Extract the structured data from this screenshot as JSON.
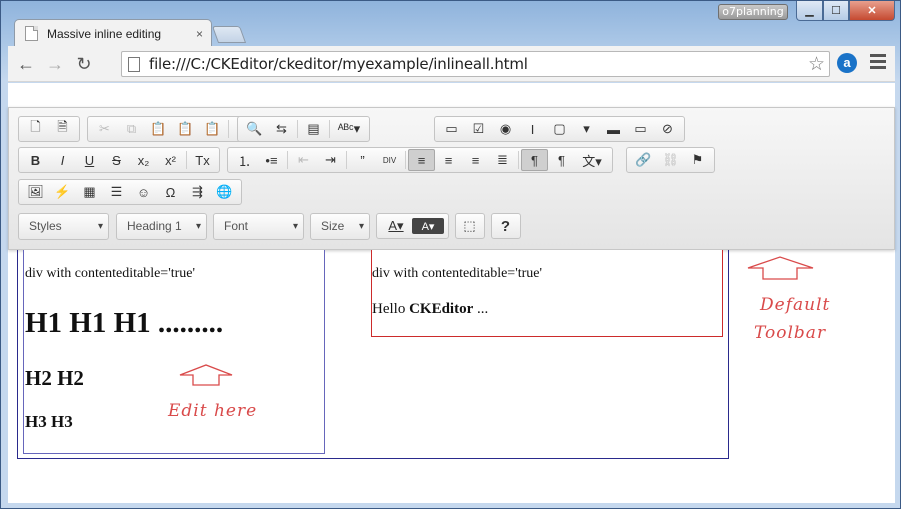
{
  "window": {
    "user_badge": "o7planning",
    "controls": {
      "minimize": "▁",
      "maximize": "☐",
      "close": "✕"
    }
  },
  "tabs": [
    {
      "label": "Massive inline editing",
      "close": "×",
      "active": true
    }
  ],
  "navbar": {
    "back": "←",
    "forward": "→",
    "reload": "↻",
    "url": "file:///C:/CKEditor/ckeditor/myexample/inlineall.html",
    "star": "☆",
    "extension": "a"
  },
  "editor_toolbar": {
    "rows": [
      [
        [
          "page-icon",
          "document-icon"
        ],
        [
          "cut-icon",
          "copy-icon",
          "paste-icon",
          "paste-text-icon",
          "paste-word-icon",
          "|",
          "undo-icon",
          "redo-icon"
        ],
        [
          "find-icon",
          "replace-icon",
          "|",
          "select-all-icon",
          "|",
          "spellcheck-icon"
        ],
        [
          "form-icon",
          "checkbox-icon",
          "radio-icon",
          "textfield-icon",
          "textarea-icon",
          "select-icon",
          "button-icon",
          "imagebutton-icon",
          "hiddenfield-icon"
        ]
      ],
      [
        [
          "bold-icon",
          "italic-icon",
          "underline-icon",
          "strike-icon",
          "subscript-icon",
          "superscript-icon",
          "|",
          "removeformat-icon"
        ],
        [
          "numbered-list-icon",
          "bulleted-list-icon",
          "|",
          "outdent-icon",
          "indent-icon",
          "|",
          "blockquote-icon",
          "creatediv-icon",
          "|",
          "align-left-icon",
          "align-center-icon",
          "align-right-icon",
          "justify-icon",
          "|",
          "ltr-icon",
          "rtl-icon",
          "language-icon"
        ],
        [
          "link-icon",
          "unlink-icon",
          "anchor-icon"
        ]
      ],
      [
        [
          "image-icon",
          "flash-icon",
          "table-icon",
          "hr-icon",
          "smiley-icon",
          "specialchar-icon",
          "pagebreak-icon",
          "iframe-icon"
        ]
      ]
    ],
    "glyphs": {
      "page-icon": "🗋",
      "document-icon": "🗎",
      "cut-icon": "✂",
      "copy-icon": "⧉",
      "paste-icon": "📋",
      "paste-text-icon": "📋",
      "paste-word-icon": "📋",
      "undo-icon": "↶",
      "redo-icon": "↷",
      "find-icon": "🔍",
      "replace-icon": "⇆",
      "select-all-icon": "▤",
      "spellcheck-icon": "ᴬᴮᶜ▾",
      "form-icon": "▭",
      "checkbox-icon": "☑",
      "radio-icon": "◉",
      "textfield-icon": "I",
      "textarea-icon": "▢",
      "select-icon": "▾",
      "button-icon": "▬",
      "imagebutton-icon": "▭",
      "hiddenfield-icon": "⊘",
      "bold-icon": "B",
      "italic-icon": "I",
      "underline-icon": "U",
      "strike-icon": "S",
      "subscript-icon": "x₂",
      "superscript-icon": "x²",
      "removeformat-icon": "Tx",
      "numbered-list-icon": "⒈",
      "bulleted-list-icon": "•≡",
      "outdent-icon": "⇤",
      "indent-icon": "⇥",
      "blockquote-icon": "”",
      "creatediv-icon": "DIV",
      "align-left-icon": "≡",
      "align-center-icon": "≡",
      "align-right-icon": "≡",
      "justify-icon": "≣",
      "ltr-icon": "¶",
      "rtl-icon": "¶",
      "language-icon": "文▾",
      "link-icon": "🔗",
      "unlink-icon": "⛓",
      "anchor-icon": "⚑",
      "image-icon": "🖼",
      "flash-icon": "⚡",
      "table-icon": "▦",
      "hr-icon": "☰",
      "smiley-icon": "☺",
      "specialchar-icon": "Ω",
      "pagebreak-icon": "⇶",
      "iframe-icon": "🌐"
    },
    "combos": {
      "styles": "Styles",
      "format": "Heading 1",
      "font": "Font",
      "size": "Size"
    },
    "text_color_icon": "A▾",
    "bg_color_icon": "A▾",
    "maximize_icon": "⬚",
    "about_icon": "?"
  },
  "content": {
    "left_div": {
      "caption": "div with contenteditable='true'",
      "h1": "H1 H1 H1 .........",
      "h2": "H2 H2",
      "h3": "H3 H3"
    },
    "right_div": {
      "caption": "div with contenteditable='true'",
      "hello_prefix": "Hello ",
      "hello_bold": "CKEditor",
      "hello_suffix": " ..."
    },
    "annotations": {
      "edit_here": "Edit here",
      "default_line1": "Default",
      "default_line2": "Toolbar"
    }
  }
}
